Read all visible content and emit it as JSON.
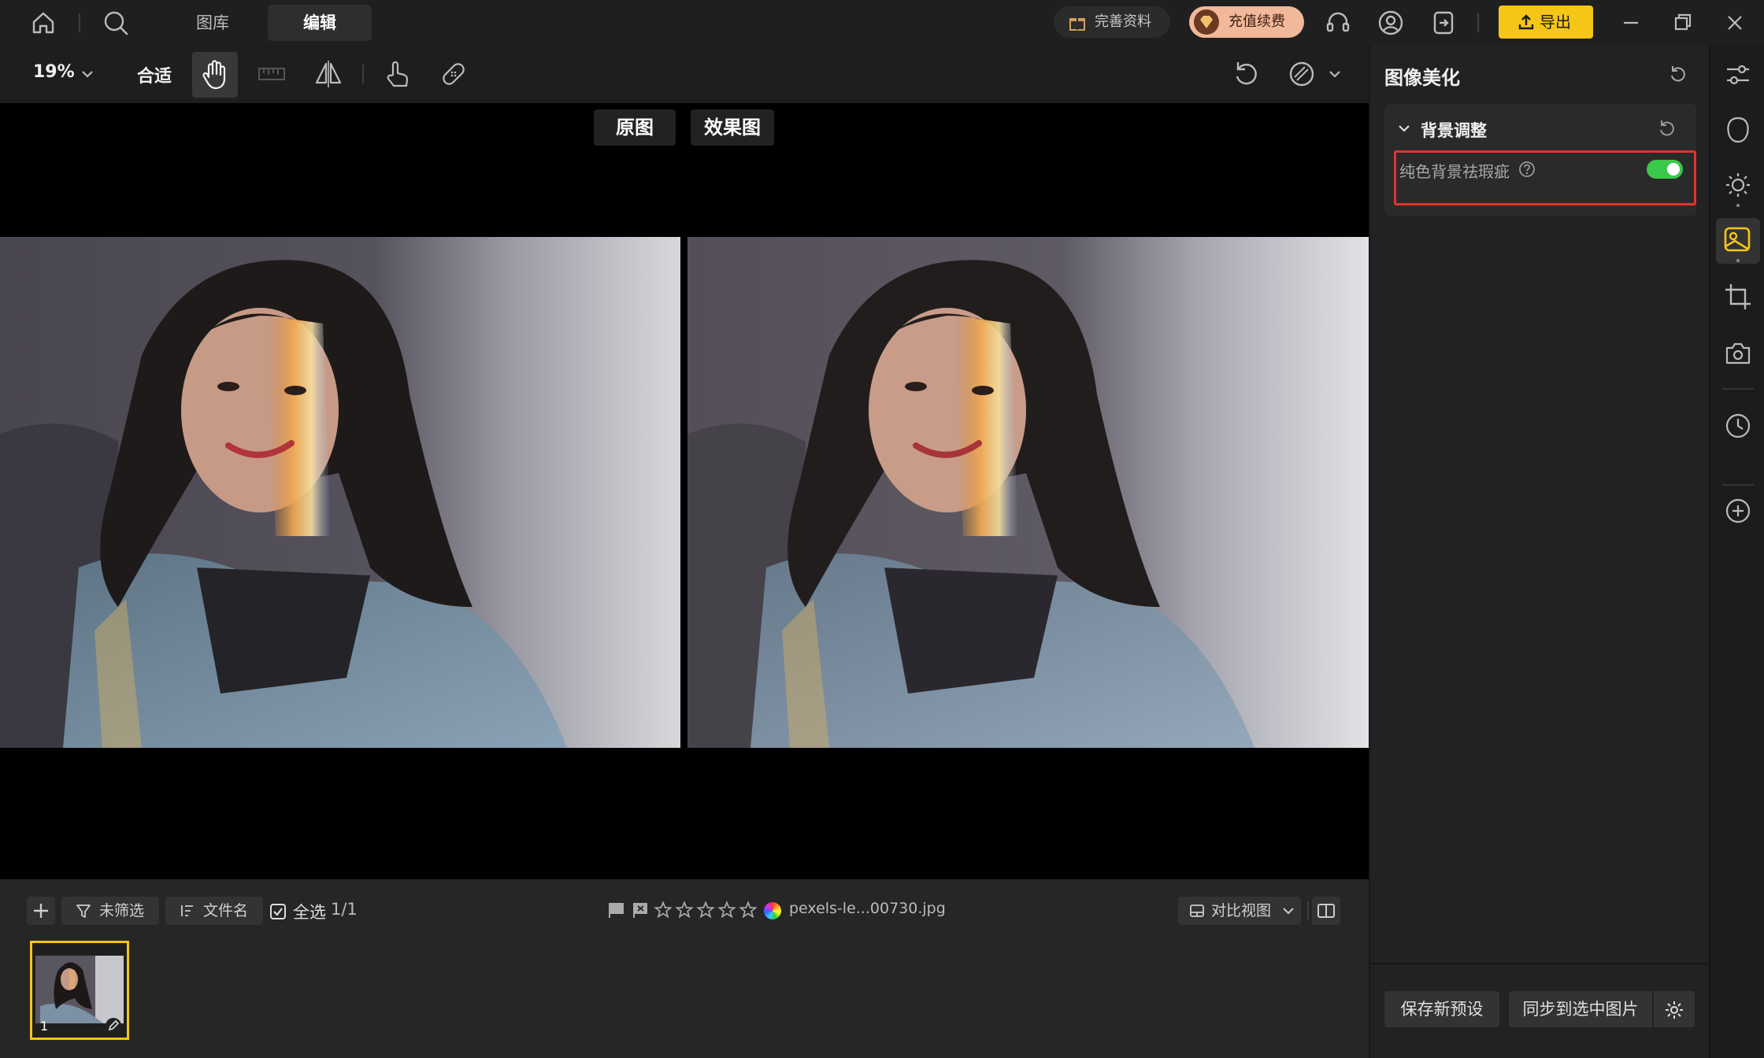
{
  "top_bar": {
    "tabs": [
      {
        "label": "图库",
        "active": false
      },
      {
        "label": "编辑",
        "active": true
      }
    ],
    "complete_profile": "完善资料",
    "recharge": "充值续费",
    "export": "导出"
  },
  "toolbar": {
    "zoom": "19%",
    "fit": "合适"
  },
  "canvas": {
    "original_label": "原图",
    "effect_label": "效果图"
  },
  "filmstrip": {
    "unfiltered": "未筛选",
    "sort_filename": "文件名",
    "select_all": "全选",
    "count": "1/1",
    "filename": "pexels-le...00730.jpg",
    "rating_stars": 5,
    "compare_view": "对比视图",
    "thumb_index": "1"
  },
  "panel": {
    "title": "图像美化",
    "section_title": "背景调整",
    "option_label": "纯色背景祛瑕疵",
    "option_enabled": true,
    "save_preset": "保存新预设",
    "sync_selected": "同步到选中图片"
  },
  "colors": {
    "accent": "#f5c518",
    "toggle_on": "#3cc84a",
    "highlight_border": "#e0342c"
  }
}
